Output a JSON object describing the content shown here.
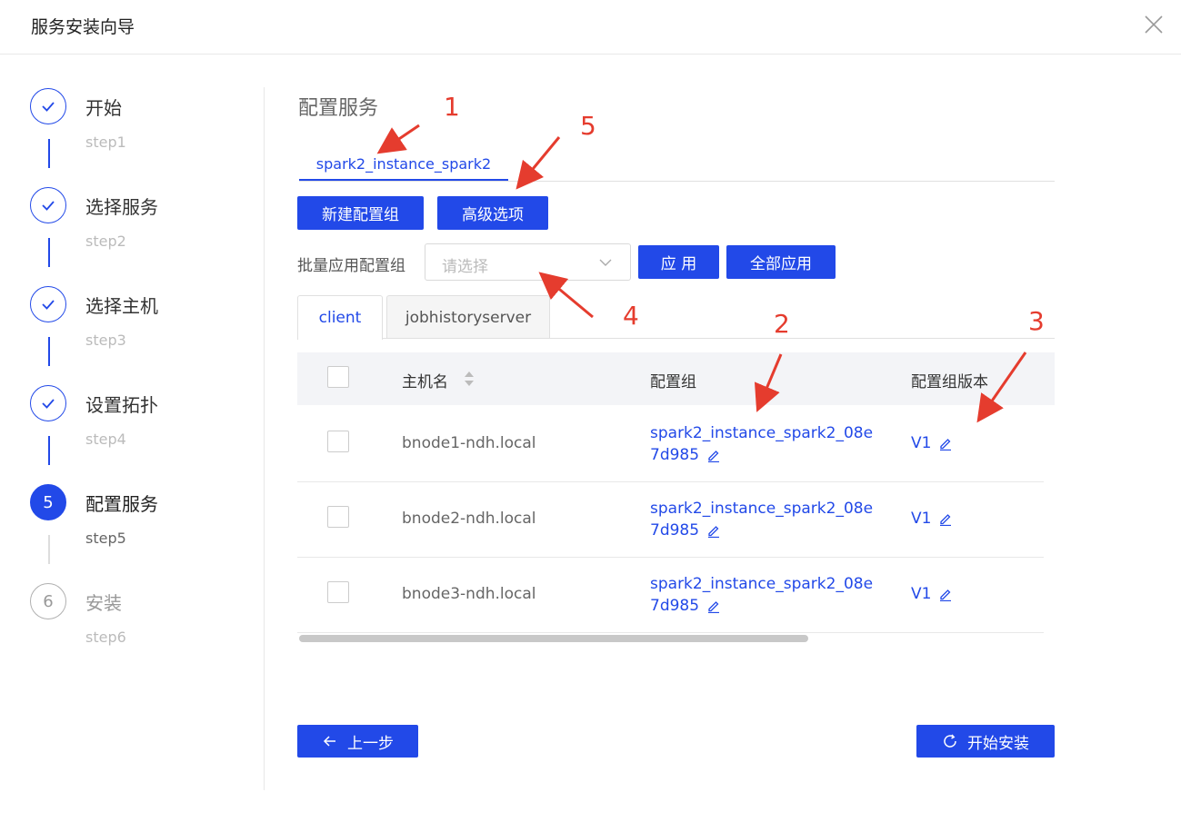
{
  "header": {
    "title": "服务安装向导",
    "close_icon": "close-icon"
  },
  "steps": [
    {
      "label": "开始",
      "sub": "step1",
      "state": "done"
    },
    {
      "label": "选择服务",
      "sub": "step2",
      "state": "done"
    },
    {
      "label": "选择主机",
      "sub": "step3",
      "state": "done"
    },
    {
      "label": "设置拓扑",
      "sub": "step4",
      "state": "done"
    },
    {
      "label": "配置服务",
      "sub": "step5",
      "state": "active",
      "number": "5"
    },
    {
      "label": "安装",
      "sub": "step6",
      "state": "todo",
      "number": "6"
    }
  ],
  "main": {
    "title": "配置服务",
    "service_tab": "spark2_instance_spark2",
    "buttons": {
      "new_group": "新建配置组",
      "advanced": "高级选项",
      "apply": "应 用",
      "apply_all": "全部应用"
    },
    "batch_label": "批量应用配置组",
    "select_placeholder": "请选择",
    "component_tabs": [
      "client",
      "jobhistoryserver"
    ],
    "table": {
      "headers": {
        "host": "主机名",
        "group": "配置组",
        "version": "配置组版本"
      },
      "rows": [
        {
          "host": "bnode1-ndh.local",
          "group_line1": "spark2_instance_spark2_08e",
          "group_line2": "7d985",
          "version": "V1"
        },
        {
          "host": "bnode2-ndh.local",
          "group_line1": "spark2_instance_spark2_08e",
          "group_line2": "7d985",
          "version": "V1"
        },
        {
          "host": "bnode3-ndh.local",
          "group_line1": "spark2_instance_spark2_08e",
          "group_line2": "7d985",
          "version": "V1"
        }
      ]
    },
    "footer": {
      "prev": "上一步",
      "install": "开始安装"
    }
  },
  "annotations": [
    "1",
    "2",
    "3",
    "4",
    "5"
  ],
  "colors": {
    "primary": "#2249e8",
    "annotation": "#e53c2e"
  }
}
